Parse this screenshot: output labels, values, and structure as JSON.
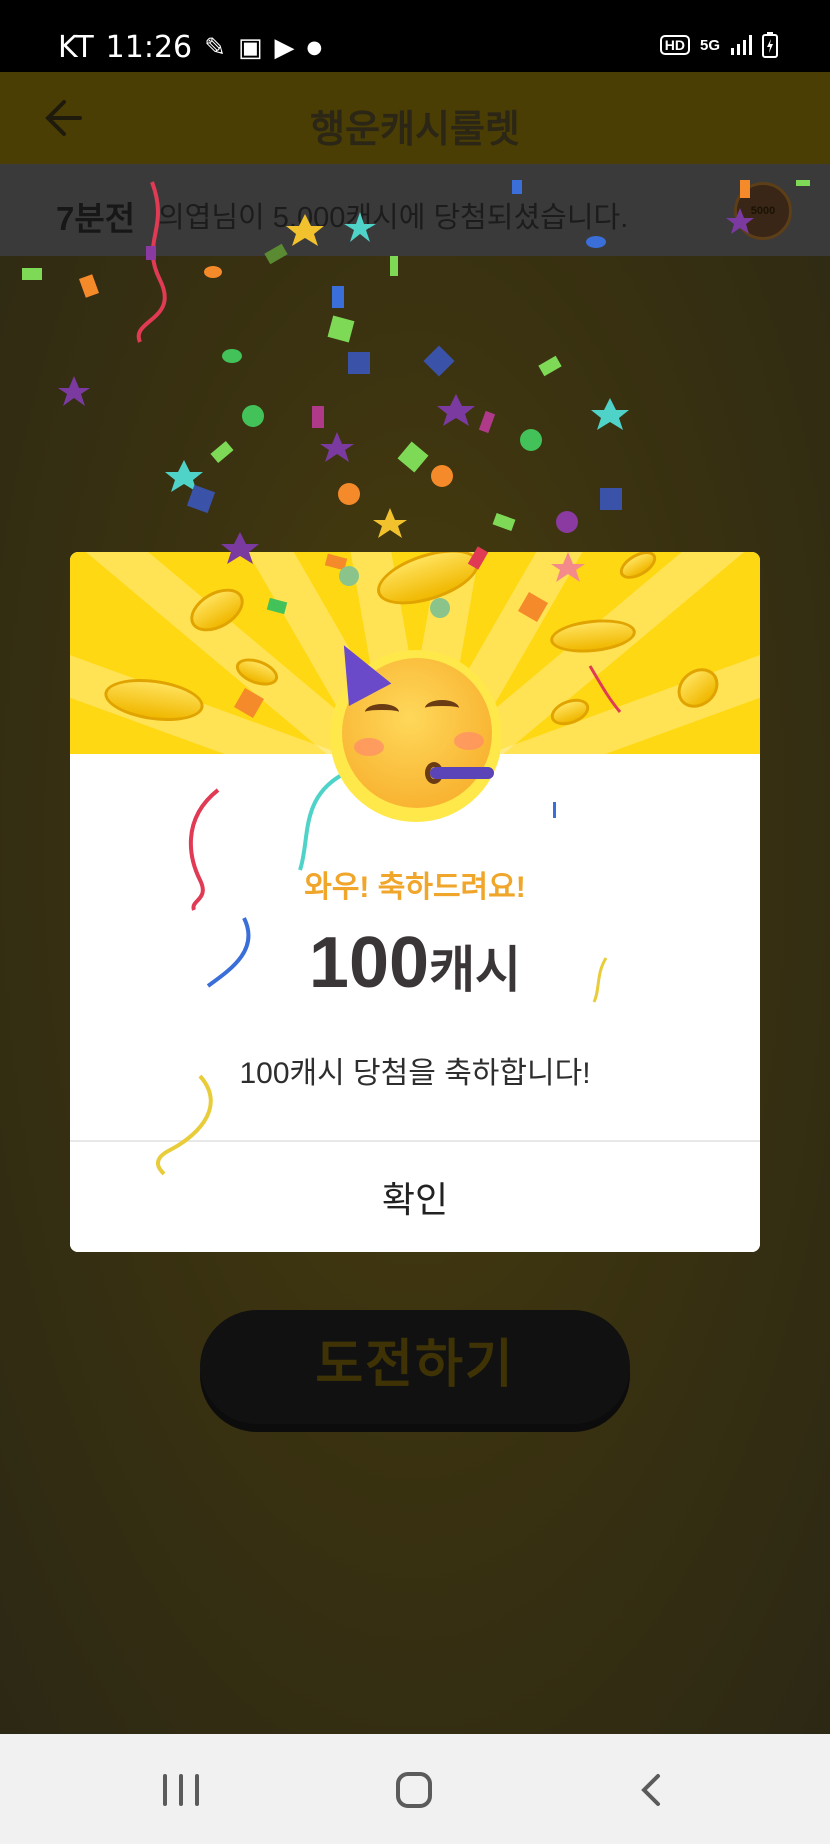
{
  "status_bar": {
    "carrier": "KT",
    "time": "11:26",
    "hd_label": "HD",
    "network_label": "5G",
    "icons": [
      "notification-icon",
      "image-icon",
      "youtube-icon",
      "dot-icon",
      "hd-voice-icon",
      "5g-icon",
      "signal-icon",
      "battery-charging-icon"
    ]
  },
  "header": {
    "title": "행운캐시룰렛",
    "back_icon": "back-arrow-icon"
  },
  "ticker": {
    "time_ago": "7분전",
    "message": "의엽님이 5,000캐시에 당첨되셨습니다.",
    "coin_label": "5000"
  },
  "modal": {
    "kicker": "와우! 축하드려요!",
    "amount_number": "100",
    "amount_unit": "캐시",
    "description": "100캐시 당첨을 축하합니다!",
    "confirm_label": "확인",
    "emoji": "partying-face-emoji"
  },
  "main": {
    "challenge_label": "도전하기"
  },
  "nav_bar": {
    "icons": [
      "recent-apps-icon",
      "home-icon",
      "back-icon"
    ]
  },
  "colors": {
    "banner_yellow": "#ffd814",
    "kicker_orange": "#f0a62a",
    "amount_text": "#3a3537",
    "dim_overlay": "#2f2a16"
  }
}
